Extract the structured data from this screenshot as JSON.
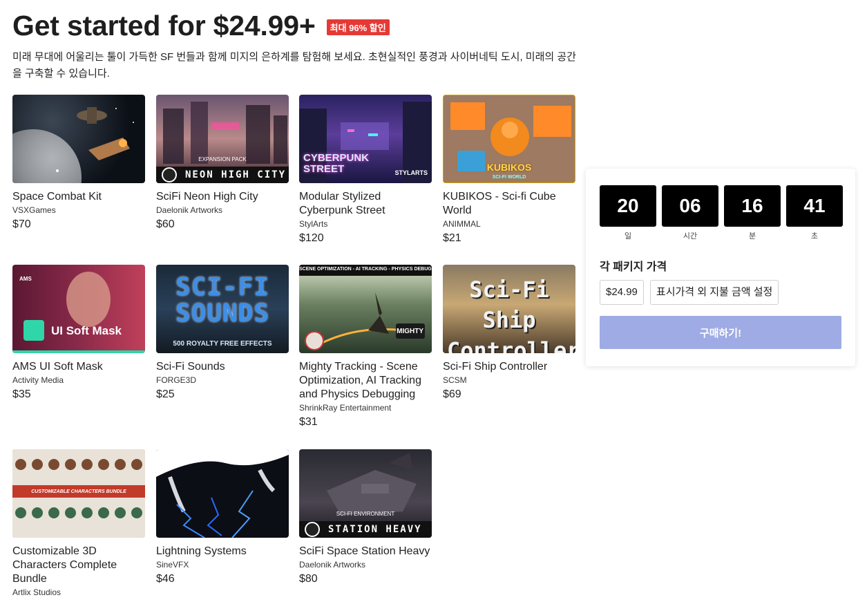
{
  "header": {
    "title": "Get started for $24.99+",
    "badge": "최대 96% 할인",
    "description": "미래 무대에 어울리는 툴이 가득한 SF 번들과 함께 미지의 은하계를 탐험해 보세요. 초현실적인 풍경과 사이버네틱 도시, 미래의 공간을 구축할 수 있습니다."
  },
  "products": [
    {
      "title": "Space Combat Kit",
      "publisher": "VSXGames",
      "price": "$70"
    },
    {
      "title": "SciFi Neon High City",
      "publisher": "Daelonik Artworks",
      "price": "$60",
      "thumb_text": "NEON HIGH CITY",
      "thumb_sub": "EXPANSION PACK"
    },
    {
      "title": "Modular Stylized Cyberpunk Street",
      "publisher": "StylArts",
      "price": "$120",
      "thumb_text": "CYBERPUNK STREET",
      "thumb_sub": "STYLARTS"
    },
    {
      "title": "KUBIKOS - Sci-fi Cube World",
      "publisher": "ANIMMAL",
      "price": "$21",
      "thumb_text": "KUBIKOS",
      "thumb_sub": "SCI-FI WORLD"
    },
    {
      "title": "AMS UI Soft Mask",
      "publisher": "Activity Media",
      "price": "$35",
      "thumb_text": "UI Soft Mask",
      "thumb_sub": "AMS"
    },
    {
      "title": "Sci-Fi Sounds",
      "publisher": "FORGE3D",
      "price": "$25",
      "thumb_text": "SCI-FI SOUNDS",
      "thumb_sub": "500 ROYALTY FREE EFFECTS"
    },
    {
      "title": "Mighty Tracking - Scene Optimization, AI Tracking and Physics Debugging",
      "publisher": "ShrinkRay Entertainment",
      "price": "$31",
      "thumb_text": "SCENE OPTIMIZATION - AI TRACKING - PHYSICS DEBUGGING",
      "thumb_sub": "MIGHTY"
    },
    {
      "title": "Sci-Fi Ship Controller",
      "publisher": "SCSM",
      "price": "$69",
      "thumb_text": "Sci-Fi Ship Controller"
    },
    {
      "title": "Customizable 3D Characters Complete Bundle",
      "publisher": "Artlix Studios",
      "price": "",
      "thumb_text": "CUSTOMIZABLE CHARACTERS BUNDLE"
    },
    {
      "title": "Lightning Systems",
      "publisher": "SineVFX",
      "price": "$46"
    },
    {
      "title": "SciFi Space Station Heavy",
      "publisher": "Daelonik Artworks",
      "price": "$80",
      "thumb_text": "STATION HEAVY",
      "thumb_sub": "SCI-FI ENVIRONMENT"
    }
  ],
  "countdown": {
    "days": "20",
    "days_label": "일",
    "hours": "06",
    "hours_label": "시간",
    "minutes": "16",
    "minutes_label": "분",
    "seconds": "41",
    "seconds_label": "초"
  },
  "pricing": {
    "label": "각 패키지 가격",
    "price_option": "$24.99",
    "custom_option": "표시가격 외 지불 금액 설정",
    "buy_label": "구매하기!"
  },
  "colors": {
    "badge": "#e53935",
    "buy_button": "#9fabe4",
    "timer_bg": "#000000"
  }
}
